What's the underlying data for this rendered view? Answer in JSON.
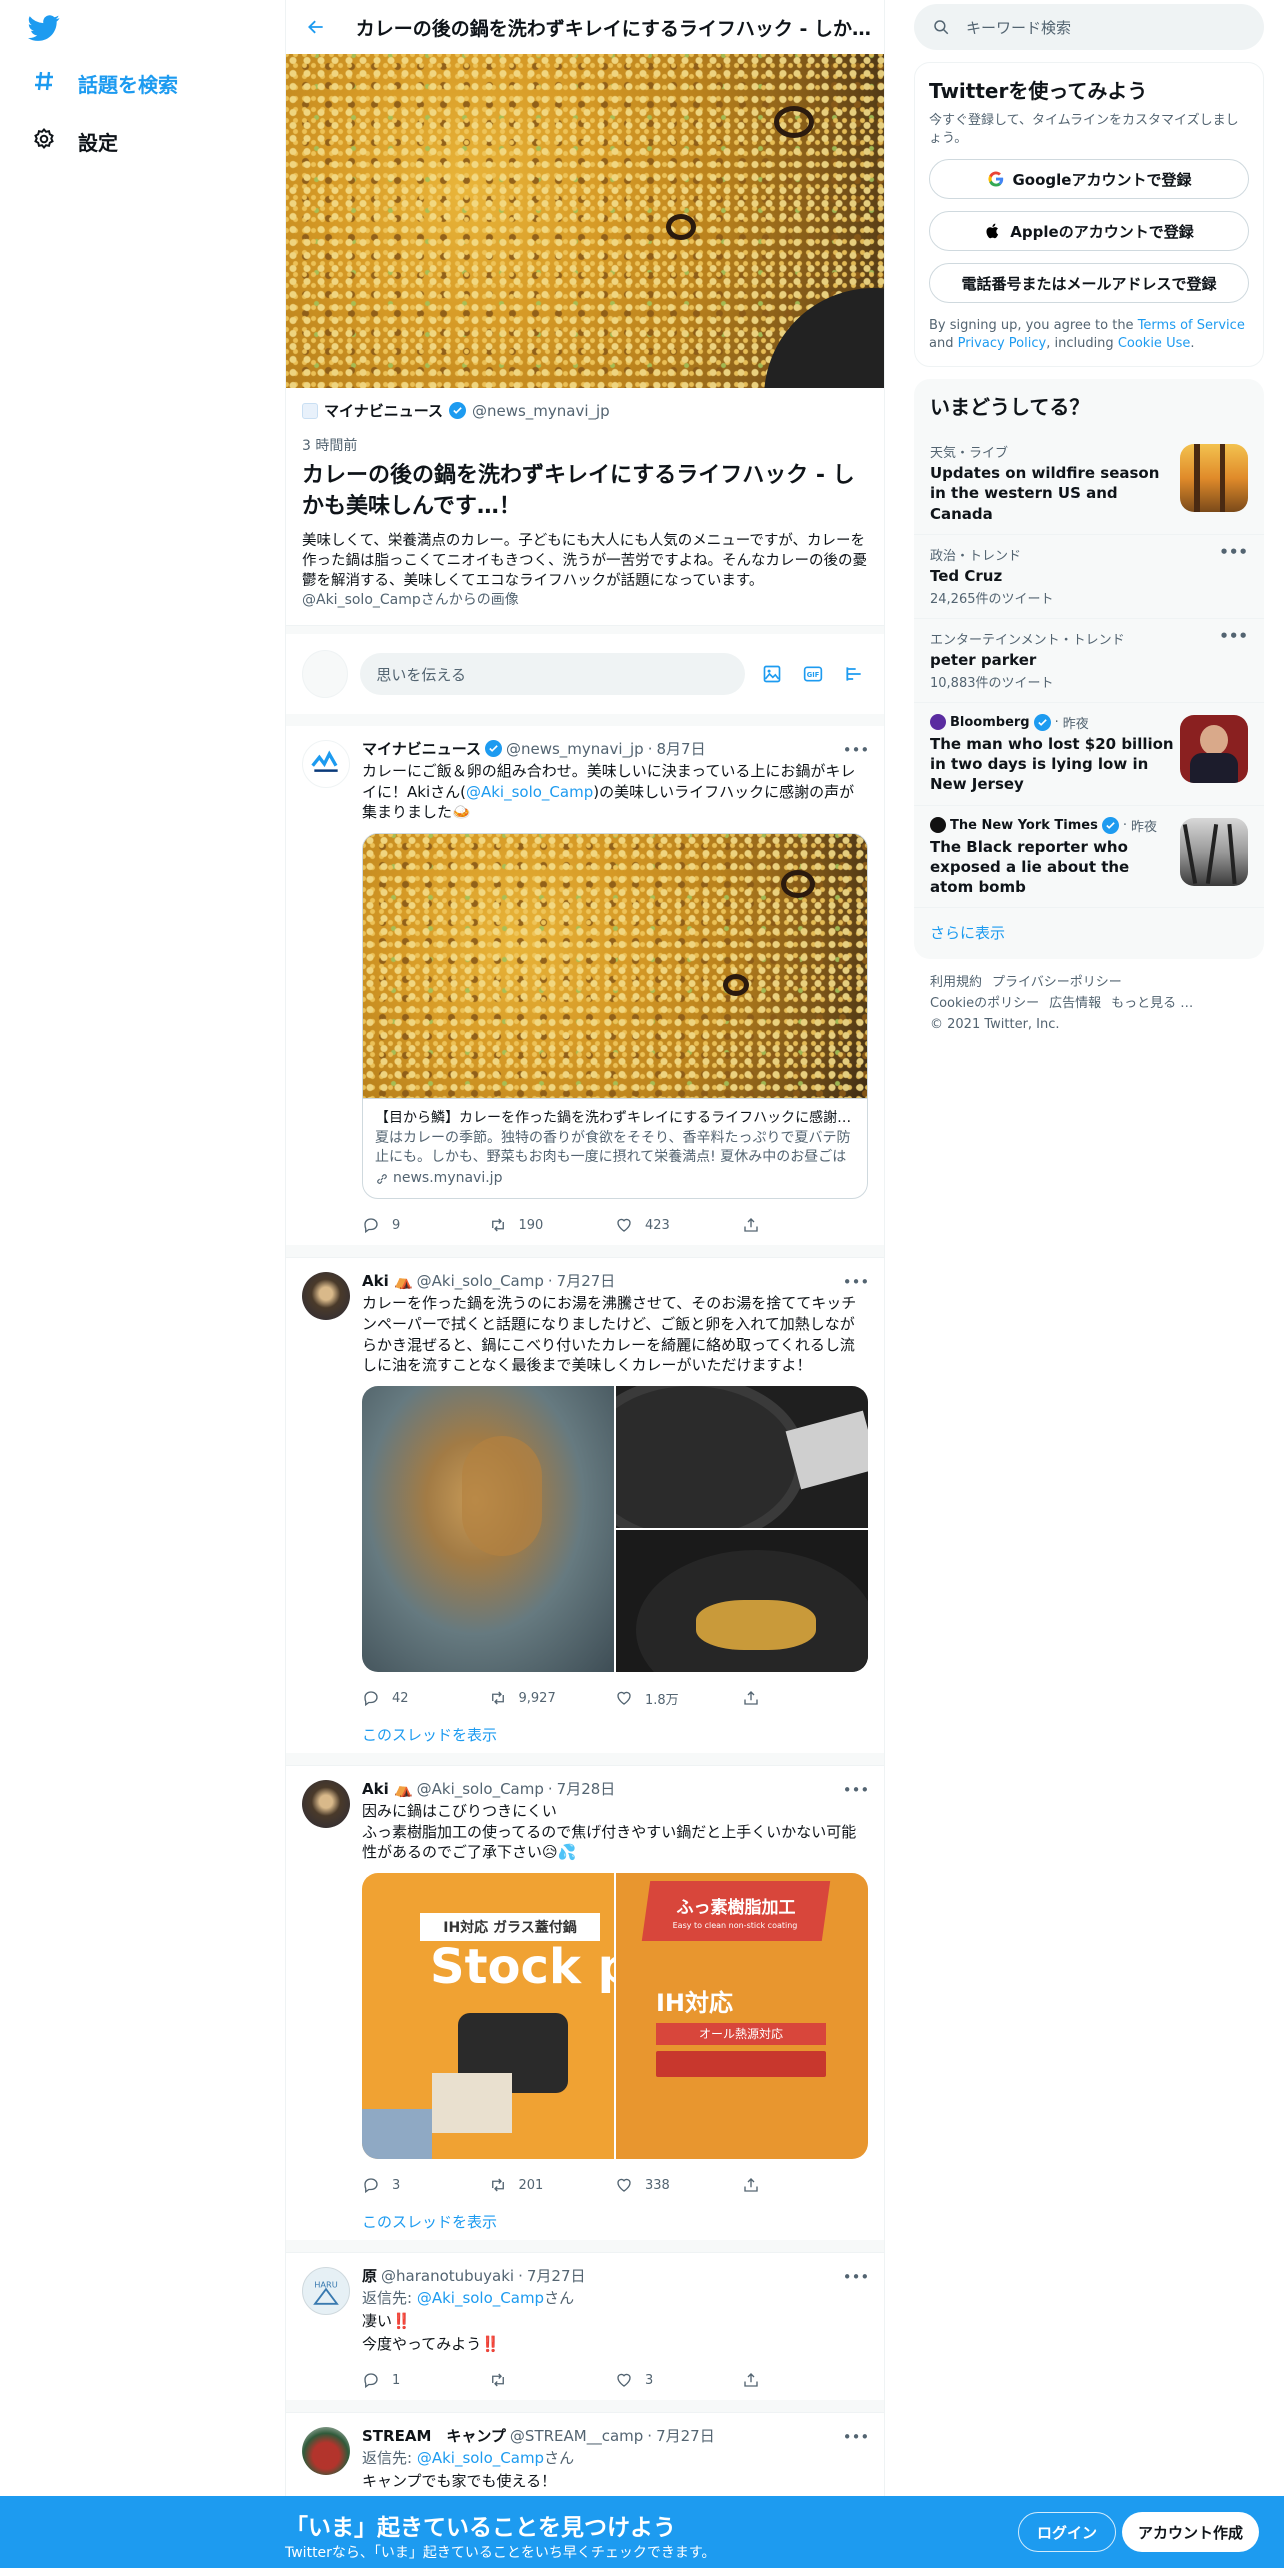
{
  "nav": {
    "explore": "話題を検索",
    "settings": "設定"
  },
  "header": {
    "title": "カレーの後の鍋を洗わずキレイにするライフハック - しかも美味しんです…！"
  },
  "article": {
    "source_name": "マイナビニュース",
    "source_handle": "@news_mynavi_jp",
    "time": "3 時間前",
    "headline": "カレーの後の鍋を洗わずキレイにするライフハック - しかも美味しんです…！",
    "description": "美味しくて、栄養満点のカレー。子どもにも大人にも人気のメニューですが、カレーを作った鍋は脂っこくてニオイもきつく、洗うが一苦労ですよね。そんなカレーの後の憂鬱を解消する、美味しくてエコなライフハックが話題になっています。",
    "credit": "@Aki_solo_Campさんからの画像"
  },
  "compose": {
    "placeholder": "思いを伝える"
  },
  "tweets": [
    {
      "name": "マイナビニュース",
      "handle": "@news_mynavi_jp",
      "date": "8月7日",
      "text_a": "カレーにご飯＆卵の組み合わせ。美味しいに決まっている上にお鍋がキレイに！Akiさん(",
      "mention": "@Aki_solo_Camp",
      "text_b": ")の美味しいライフハックに感謝の声が集まりました🍛",
      "card_title": "【目から鱗】カレーを作った鍋を洗わずキレイにするライフハックに感謝の声！",
      "card_desc": "夏はカレーの季節。独特の香りが食欲をそそり、香辛料たっぷりで夏バテ防止にも。しかも、野菜もお肉も一度に摂れて栄養満点! 夏休み中のお昼ごはんにもぴったりです。",
      "card_domain": "news.mynavi.jp",
      "replies": "9",
      "retweets": "190",
      "likes": "423"
    },
    {
      "name": "Aki ⛺",
      "handle": "@Aki_solo_Camp",
      "date": "7月27日",
      "text": "カレーを作った鍋を洗うのにお湯を沸騰させて、そのお湯を捨ててキッチンペーパーで拭くと話題になりましたけど、ご飯と卵を入れて加熱しながらかき混ぜると、鍋にこべり付いたカレーを綺麗に絡め取ってくれるし流しに油を流すことなく最後まで美味しくカレーがいただけますよ！",
      "replies": "42",
      "retweets": "9,927",
      "likes": "1.8万",
      "show_thread": "このスレッドを表示"
    },
    {
      "name": "Aki ⛺",
      "handle": "@Aki_solo_Camp",
      "date": "7月28日",
      "text": "因みに鍋はこびりつきにくい\nふっ素樹脂加工の使ってるので焦げ付きやすい鍋だと上手くいかない可能性があるのでご了承下さい😥💦",
      "img1_label": "Stock p",
      "img1_banner": "IH対応 ガラス蓋付鍋",
      "img2_banner": "ふっ素樹脂加工",
      "img2_sub": "Easy to clean non-stick coating",
      "img2_ih": "IH対応",
      "img2_allfire": "オール熱源対応",
      "replies": "3",
      "retweets": "201",
      "likes": "338",
      "show_thread": "このスレッドを表示"
    },
    {
      "name": "原",
      "handle": "@haranotubuyaki",
      "date": "7月27日",
      "reply_prefix": "返信先: ",
      "reply_to": "@Aki_solo_Camp",
      "reply_suffix": "さん",
      "line1": "凄い‼️",
      "line2": "今度やってみよう‼️",
      "replies": "1",
      "retweets": "",
      "likes": "3"
    },
    {
      "name": "STREAM　キャンプ",
      "handle": "@STREAM__camp",
      "date": "7月27日",
      "reply_prefix": "返信先: ",
      "reply_to": "@Aki_solo_Camp",
      "reply_suffix": "さん",
      "line1": "キャンプでも家でも使える！"
    }
  ],
  "search": {
    "placeholder": "キーワード検索"
  },
  "signup": {
    "title": "Twitterを使ってみよう",
    "subtitle": "今すぐ登録して、タイムラインをカスタマイズしましょう。",
    "google": "Googleアカウントで登録",
    "apple": "Appleのアカウントで登録",
    "phone": "電話番号またはメールアドレスで登録",
    "legal_a": "By signing up, you agree to the ",
    "tos": "Terms of Service",
    "legal_b": " and ",
    "privacy": "Privacy Policy",
    "legal_c": ", including ",
    "cookie": "Cookie Use",
    "legal_d": "."
  },
  "trends": {
    "title": "いまどうしてる？",
    "items": [
      {
        "category": "天気・ライブ",
        "title": "Updates on wildfire season in the western US and Canada"
      },
      {
        "category": "政治・トレンド",
        "title": "Ted Cruz",
        "count": "24,265件のツイート"
      },
      {
        "category": "エンターテインメント・トレンド",
        "title": "peter parker",
        "count": "10,883件のツイート"
      },
      {
        "source": "Bloomberg",
        "when": "昨夜",
        "title": "The man who lost $20 billion in two days is lying low in New Jersey"
      },
      {
        "source": "The New York Times",
        "when": "昨夜",
        "title": "The Black reporter who exposed a lie about the atom bomb"
      }
    ],
    "show_more": "さらに表示"
  },
  "footer": {
    "terms": "利用規約",
    "privacy": "プライバシーポリシー",
    "cookie": "Cookieのポリシー",
    "ads": "広告情報",
    "more": "もっと見る …",
    "copyright": "© 2021 Twitter, Inc."
  },
  "bottombar": {
    "title": "「いま」起きていることを見つけよう",
    "subtitle": "Twitterなら、「いま」起きていることをいち早くチェックできます。",
    "login": "ログイン",
    "signup": "アカウント作成"
  },
  "colors": {
    "accent": "#1d9bf0",
    "text": "#0f1419",
    "muted": "#536471"
  }
}
